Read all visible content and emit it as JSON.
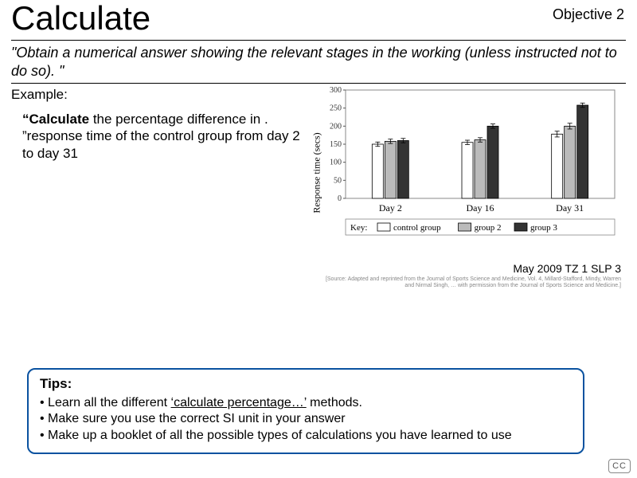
{
  "header": {
    "title": "Calculate",
    "objective": "Objective 2"
  },
  "quote": "\"Obtain a numerical answer showing the relevant stages in the working (unless instructed not to do so). \"",
  "example": {
    "label": "Example:",
    "prompt_bold": "“Calculate",
    "prompt_rest": " the percentage difference in . ”response time of the control group from day 2 to day 31"
  },
  "chart_data": {
    "type": "bar",
    "title": "",
    "xlabel": "",
    "ylabel": "Response time (secs)",
    "ylim": [
      0,
      300
    ],
    "yticks": [
      0,
      50,
      100,
      150,
      200,
      250,
      300
    ],
    "categories": [
      "Day 2",
      "Day 16",
      "Day 31"
    ],
    "series": [
      {
        "name": "control group",
        "values": [
          150,
          155,
          178
        ],
        "err": [
          6,
          6,
          8
        ]
      },
      {
        "name": "group 2",
        "values": [
          158,
          162,
          200
        ],
        "err": [
          6,
          6,
          8
        ]
      },
      {
        "name": "group 3",
        "values": [
          160,
          200,
          258
        ],
        "err": [
          6,
          6,
          6
        ]
      }
    ],
    "legend_title": "Key:",
    "caption": "May 2009 TZ 1 SLP 3",
    "source_note": "[Source: Adapted and reprinted from the Journal of Sports Science and Medicine, Vol. 4, Millard-Stafford, Mindy, Warren and Nirmal Singh, … with permission from the Journal of Sports Science and Medicine.]"
  },
  "tips": {
    "title": "Tips:",
    "items": [
      {
        "pre": "Learn all the different ",
        "u": "‘calculate percentage…’",
        "post": " methods."
      },
      {
        "pre": "Make sure you use the correct SI unit in your answer",
        "u": "",
        "post": ""
      },
      {
        "pre": "Make up a booklet of all the possible types of calculations you have learned to use",
        "u": "",
        "post": ""
      }
    ]
  },
  "cc": "CC"
}
